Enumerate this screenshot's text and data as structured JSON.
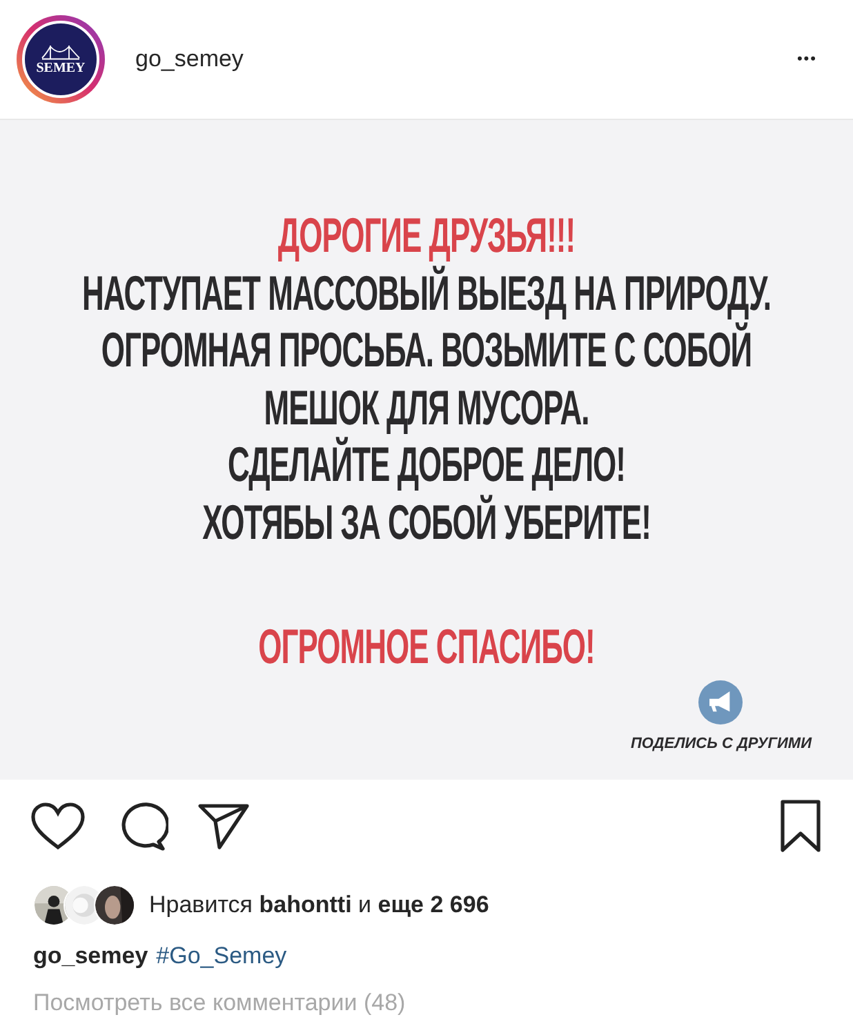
{
  "header": {
    "avatar_text": "SEMEY",
    "username": "go_semey",
    "more": "•••"
  },
  "post": {
    "lines": [
      {
        "text": "ДОРОГИЕ ДРУЗЬЯ!!!",
        "kind": "accent"
      },
      {
        "text": "НАСТУПАЕТ МАССОВЫЙ ВЫЕЗД НА ПРИРОДУ.",
        "kind": "plain"
      },
      {
        "text": "ОГРОМНАЯ ПРОСЬБА. ВОЗЬМИТЕ С СОБОЙ",
        "kind": "plain"
      },
      {
        "text": "МЕШОК ДЛЯ МУСОРА.",
        "kind": "plain"
      },
      {
        "text": "СДЕЛАЙТЕ ДОБРОЕ ДЕЛО!",
        "kind": "plain"
      },
      {
        "text": "ХОТЯБЫ ЗА СОБОЙ УБЕРИТЕ!",
        "kind": "plain"
      },
      {
        "text": "ОГРОМНОЕ СПАСИБО!",
        "kind": "accent",
        "gap": true
      }
    ],
    "share_label": "ПОДЕЛИСЬ С ДРУГИМИ"
  },
  "likes": {
    "text": "Нравится **bahontti** и **еще 2 696**"
  },
  "caption": {
    "username": "go_semey",
    "hashtag": "#Go_Semey"
  },
  "comments_link": "Посмотреть все комментарии (48)"
}
